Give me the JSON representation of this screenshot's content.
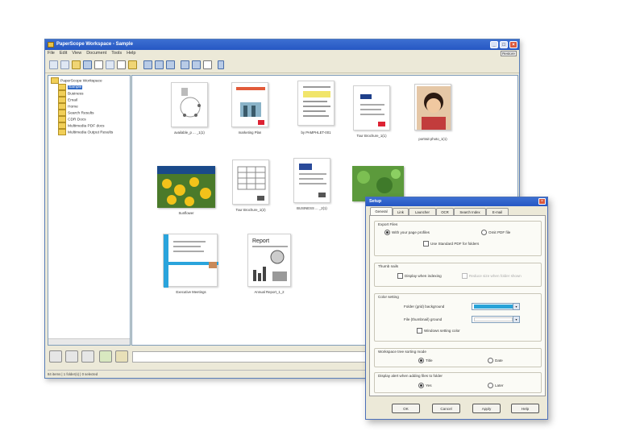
{
  "window": {
    "title": "PaperScope Workspace - Sample",
    "controls": {
      "minimize": "_",
      "maximize": "□",
      "close": "×"
    },
    "restore_label": "Restore",
    "menus": [
      "File",
      "Edit",
      "View",
      "Document",
      "Tools",
      "Help"
    ]
  },
  "tree": {
    "root": "PaperScope Workspace",
    "items": [
      {
        "label": "Sample",
        "selected": true
      },
      {
        "label": "Business"
      },
      {
        "label": "Email"
      },
      {
        "label": "Home"
      },
      {
        "label": "Search Results"
      },
      {
        "label": "CDR Docs"
      },
      {
        "label": "Multimedia PDF docs"
      },
      {
        "label": "Multimedia Output Results"
      }
    ]
  },
  "thumbnails": [
    {
      "caption": "available_p ...  _1(1)"
    },
    {
      "caption": "marketing Plan"
    },
    {
      "caption": "by PAMPHLET-001"
    },
    {
      "caption": "Tour Brochure_1(1)"
    },
    {
      "caption": "portrait photo_1(1)"
    },
    {
      "caption": "Sunflower"
    },
    {
      "caption": "Tour Brochure_1(2)"
    },
    {
      "caption": "BUSINESS ... _2(1)"
    },
    {
      "caption": ""
    },
    {
      "caption": "Executive Meetings"
    },
    {
      "caption": "Annual Report_1_2"
    }
  ],
  "status": {
    "text": "84 items | 1 folder(s) | 0 selected"
  },
  "dialog": {
    "title": "Setup",
    "tabs": [
      "General",
      "Link",
      "Launcher",
      "OCR",
      "Search Index",
      "E-mail"
    ],
    "groups": {
      "export": {
        "label": "Export Files",
        "opt1": "With your page profiles",
        "opt2": "Omit PDF file",
        "check": "Use Standard PDF for folders"
      },
      "thumbs": {
        "label": "Thumb nails",
        "check": "Display when indexing",
        "dim": "Reduce size when folder shown"
      },
      "color": {
        "label": "Color setting",
        "bg_label": "Folder (grid) background",
        "bg_color": "#29a3d8",
        "fg_label": "File (thumbnail) ground",
        "fg_color": "#ffffff",
        "check": "Windows setting color"
      },
      "sort": {
        "label": "Workspace tree sorting mode",
        "opt1": "Title",
        "opt2": "Date"
      },
      "warn": {
        "label": "Display alert when adding files to folder",
        "opt1": "Yes",
        "opt2": "Later"
      }
    },
    "buttons": {
      "ok": "OK",
      "cancel": "Cancel",
      "apply": "Apply",
      "help": "Help"
    }
  }
}
